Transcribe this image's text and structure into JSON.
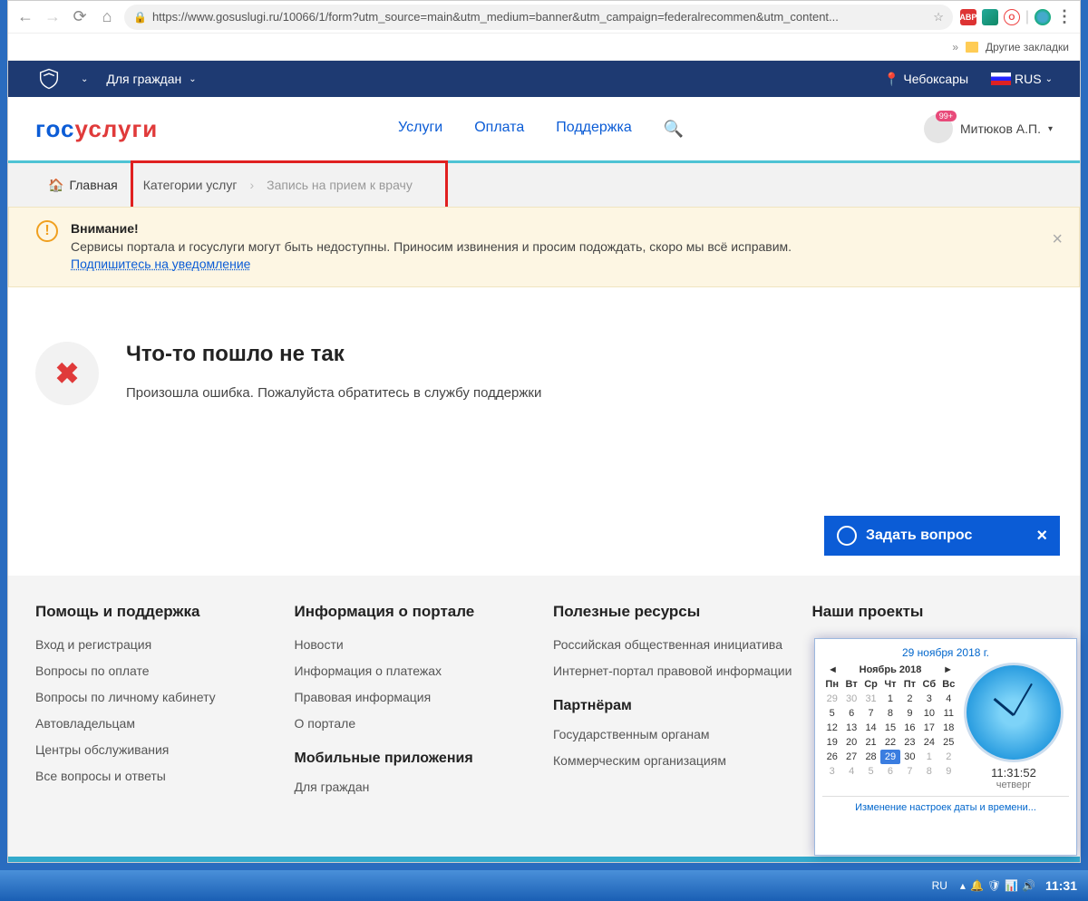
{
  "browser": {
    "url": "https://www.gosuslugi.ru/10066/1/form?utm_source=main&utm_medium=banner&utm_campaign=federalrecommen&utm_content...",
    "bookmarks_label": "Другие закладки"
  },
  "topbar": {
    "audience": "Для граждан",
    "location": "Чебоксары",
    "lang": "RUS"
  },
  "logo": {
    "part1": "гос",
    "part2": "услуги"
  },
  "nav": {
    "services": "Услуги",
    "payment": "Оплата",
    "support": "Поддержка"
  },
  "user": {
    "badge": "99+",
    "name": "Митюков А.П."
  },
  "breadcrumb": {
    "home": "Главная",
    "cats": "Категории услуг",
    "current": "Запись на прием к врачу"
  },
  "alert": {
    "title": "Внимание!",
    "text": "Сервисы портала и госуслуги могут быть недоступны. Приносим извинения и просим подождать, скоро мы всё исправим.",
    "link": "Подпишитесь на уведомление"
  },
  "error": {
    "title": "Что-то пошло не так",
    "text": "Произошла ошибка. Пожалуйста обратитесь в службу поддержки"
  },
  "ask": "Задать вопрос",
  "footer": {
    "c1": {
      "h": "Помощь и поддержка",
      "l": [
        "Вход и регистрация",
        "Вопросы по оплате",
        "Вопросы по личному кабинету",
        "Автовладельцам",
        "Центры обслуживания",
        "Все вопросы и ответы"
      ]
    },
    "c2": {
      "h": "Информация о портале",
      "l": [
        "Новости",
        "Информация о платежах",
        "Правовая информация",
        "О портале"
      ],
      "h2": "Мобильные приложения",
      "l2": [
        "Для граждан"
      ]
    },
    "c3": {
      "h": "Полезные ресурсы",
      "l": [
        "Российская общественная инициатива",
        "Интернет-портал правовой информации"
      ],
      "h2": "Партнёрам",
      "l2": [
        "Государственным органам",
        "Коммерческим организациям"
      ]
    },
    "c4": {
      "h": "Наши проекты"
    }
  },
  "calendar": {
    "date": "29 ноября 2018 г.",
    "month": "Ноябрь 2018",
    "days": [
      "Пн",
      "Вт",
      "Ср",
      "Чт",
      "Пт",
      "Сб",
      "Вс"
    ],
    "time": "11:31:52",
    "day": "четверг",
    "link": "Изменение настроек даты и времени..."
  },
  "taskbar": {
    "lang": "RU",
    "time": "11:31"
  }
}
